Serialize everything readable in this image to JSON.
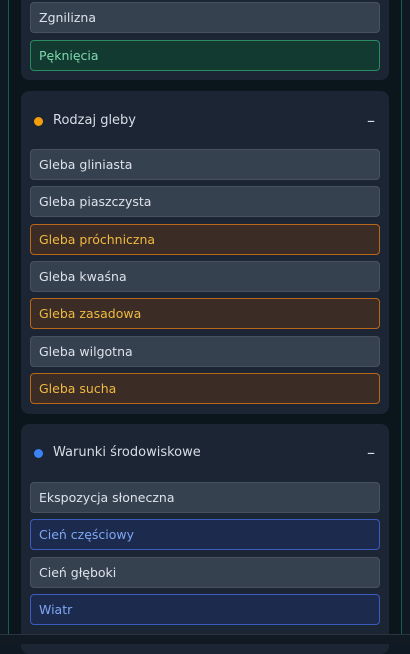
{
  "panel0": {
    "items": [
      {
        "label": "Zgnilizna",
        "state": "normal"
      },
      {
        "label": "Pęknięcia",
        "state": "green"
      }
    ]
  },
  "panel1": {
    "title": "Rodzaj gleby",
    "dot_color": "#f59e0b",
    "collapse_symbol": "–",
    "items": [
      {
        "label": "Gleba gliniasta",
        "state": "normal"
      },
      {
        "label": "Gleba piaszczysta",
        "state": "normal"
      },
      {
        "label": "Gleba próchniczna",
        "state": "orange"
      },
      {
        "label": "Gleba kwaśna",
        "state": "normal"
      },
      {
        "label": "Gleba zasadowa",
        "state": "orange"
      },
      {
        "label": "Gleba wilgotna",
        "state": "normal"
      },
      {
        "label": "Gleba sucha",
        "state": "orange"
      }
    ]
  },
  "panel2": {
    "title": "Warunki środowiskowe",
    "dot_color": "#3b82f6",
    "collapse_symbol": "–",
    "items": [
      {
        "label": "Ekspozycja słoneczna",
        "state": "normal"
      },
      {
        "label": "Cień częściowy",
        "state": "blue"
      },
      {
        "label": "Cień głęboki",
        "state": "normal"
      },
      {
        "label": "Wiatr",
        "state": "blue"
      }
    ]
  },
  "colors": {
    "selected_green": "#7fd9ad",
    "selected_orange": "#f2b940",
    "selected_blue": "#7ea7f5"
  }
}
